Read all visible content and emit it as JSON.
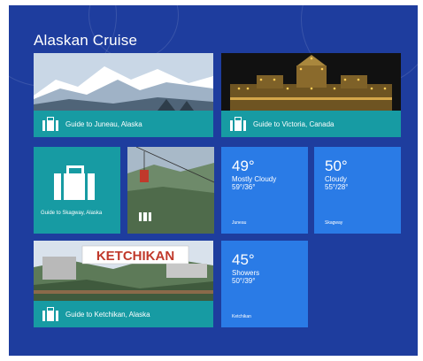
{
  "app": {
    "title": "Alaskan Cruise"
  },
  "colors": {
    "background": "#1e3d9e",
    "guide_tile": "#179ba3",
    "weather_tile": "#2a7be6"
  },
  "guides": {
    "juneau": {
      "label": "Guide to Juneau, Alaska",
      "icon": "suitcase-icon"
    },
    "victoria": {
      "label": "Guide to Victoria, Canada",
      "icon": "suitcase-icon"
    },
    "skagway": {
      "label": "Guide to Skagway, Alaska",
      "icon": "suitcase-icon"
    },
    "ketchikan": {
      "label": "Guide to Ketchikan, Alaska",
      "icon": "suitcase-icon",
      "sign_text": "KETCHIKAN"
    }
  },
  "weather": {
    "juneau": {
      "temp": "49°",
      "condition": "Mostly Cloudy",
      "range": "59°/36°",
      "city": "Juneau"
    },
    "skagway": {
      "temp": "50°",
      "condition": "Cloudy",
      "range": "55°/28°",
      "city": "Skagway"
    },
    "ketchikan": {
      "temp": "45°",
      "condition": "Showers",
      "range": "50°/39°",
      "city": "Ketchikan"
    }
  }
}
